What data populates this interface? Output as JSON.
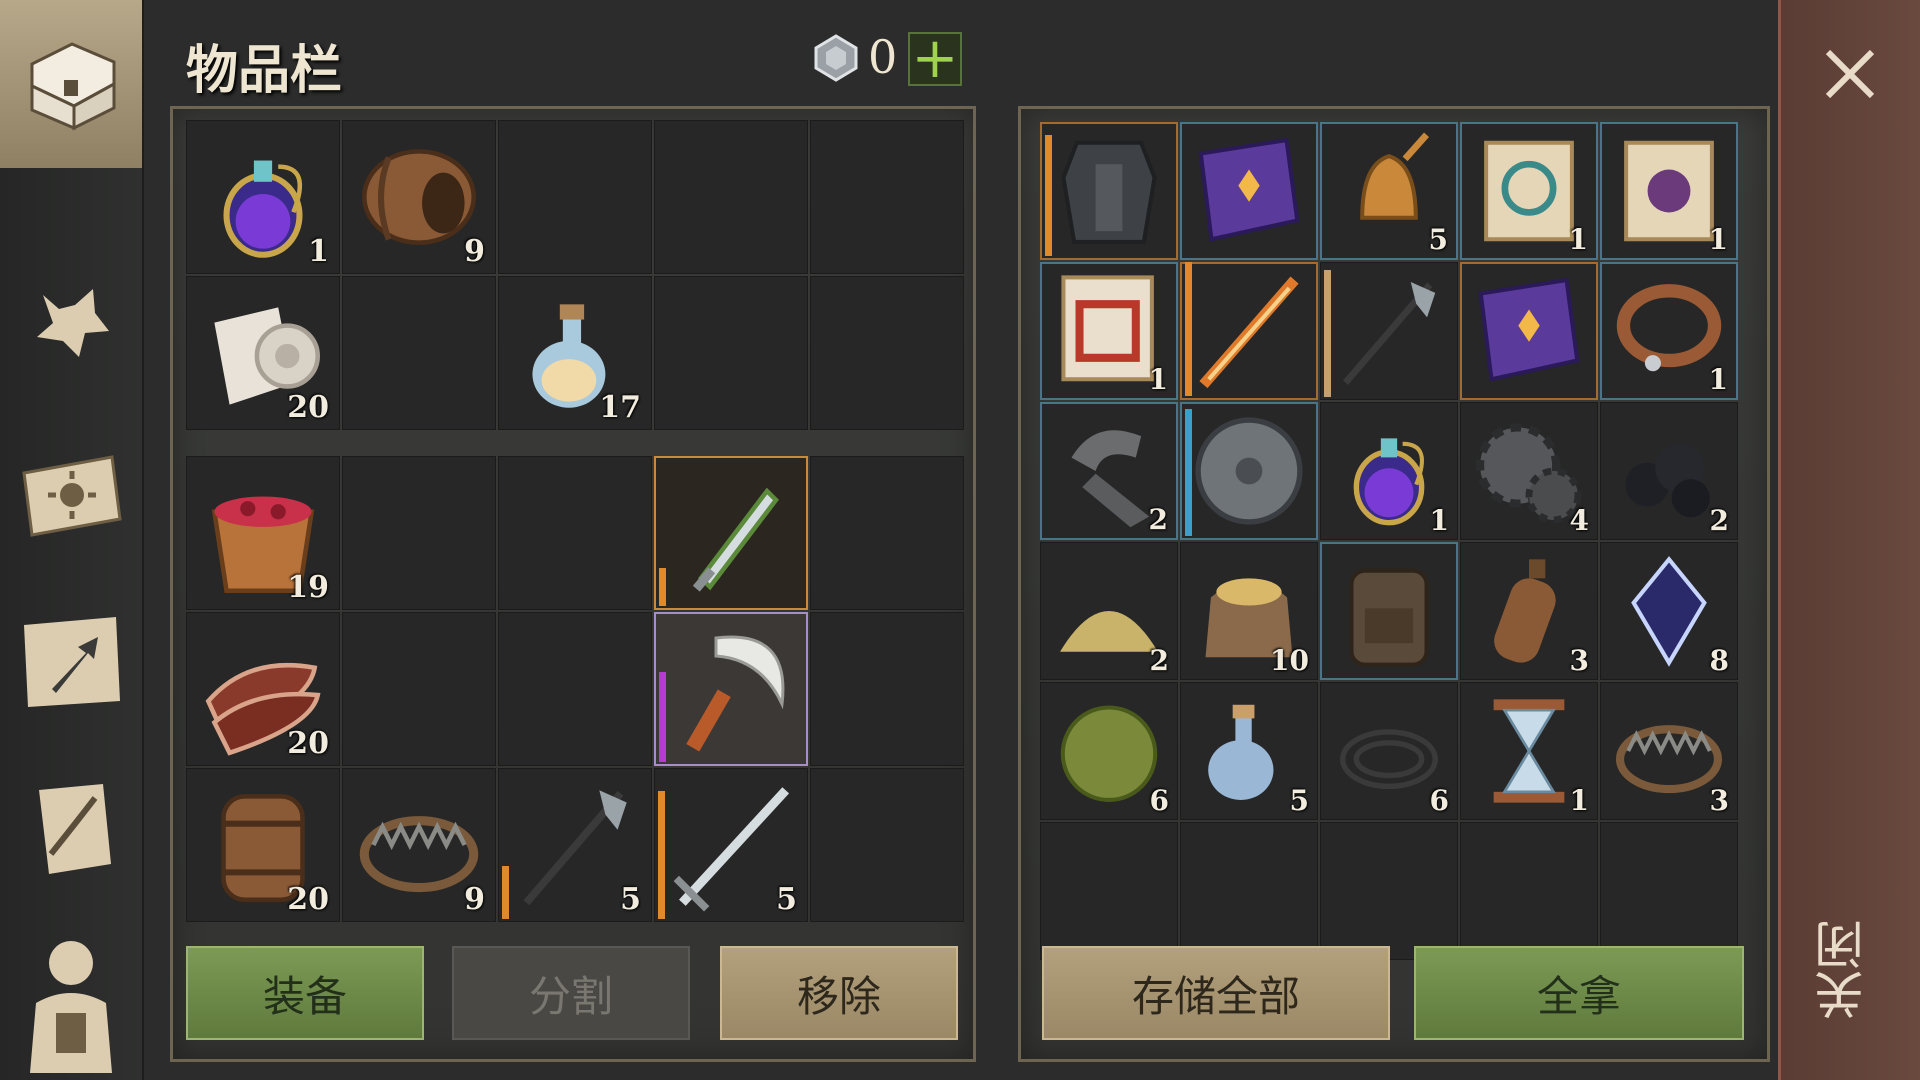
{
  "header": {
    "title": "物品栏",
    "coin_count": "0",
    "add_label": "+"
  },
  "left_nav": [
    {
      "name": "chest-icon"
    },
    {
      "name": "wolf-icon"
    },
    {
      "name": "sun-book-icon"
    },
    {
      "name": "map-arrow-icon"
    },
    {
      "name": "scroll-feather-icon"
    },
    {
      "name": "backpack-character-icon"
    }
  ],
  "inventory": [
    {
      "item": "purple-potion",
      "count": "1"
    },
    {
      "item": "barrel",
      "count": "9"
    },
    {
      "item": "",
      "count": ""
    },
    {
      "item": "",
      "count": ""
    },
    {
      "item": "",
      "count": ""
    },
    {
      "item": "cloth-roll",
      "count": "20"
    },
    {
      "item": "",
      "count": ""
    },
    {
      "item": "milk-bottle",
      "count": "17"
    },
    {
      "item": "",
      "count": ""
    },
    {
      "item": "",
      "count": ""
    },
    {
      "item": "berry-bucket",
      "count": "19"
    },
    {
      "item": "",
      "count": ""
    },
    {
      "item": "",
      "count": ""
    },
    {
      "item": "green-dagger",
      "count": ""
    },
    {
      "item": "",
      "count": ""
    },
    {
      "item": "meat-slabs",
      "count": "20"
    },
    {
      "item": "",
      "count": ""
    },
    {
      "item": "",
      "count": ""
    },
    {
      "item": "sickle",
      "count": ""
    },
    {
      "item": "",
      "count": ""
    },
    {
      "item": "keg",
      "count": "20"
    },
    {
      "item": "bear-trap",
      "count": "9"
    },
    {
      "item": "halberd",
      "count": "5"
    },
    {
      "item": "longsword",
      "count": "5"
    },
    {
      "item": "",
      "count": ""
    }
  ],
  "storage": [
    {
      "item": "chainmail",
      "count": ""
    },
    {
      "item": "purple-book",
      "count": ""
    },
    {
      "item": "bell",
      "count": "5"
    },
    {
      "item": "scroll-teal",
      "count": "1"
    },
    {
      "item": "scroll-purple",
      "count": "1"
    },
    {
      "item": "scroll-red",
      "count": "1"
    },
    {
      "item": "flame-sword",
      "count": ""
    },
    {
      "item": "halberd",
      "count": ""
    },
    {
      "item": "purple-book",
      "count": ""
    },
    {
      "item": "leather-collar",
      "count": "1"
    },
    {
      "item": "clamp",
      "count": "2"
    },
    {
      "item": "round-shield",
      "count": ""
    },
    {
      "item": "purple-potion",
      "count": "1"
    },
    {
      "item": "gears",
      "count": "4"
    },
    {
      "item": "coal",
      "count": "2"
    },
    {
      "item": "grain-pile",
      "count": "2"
    },
    {
      "item": "grain-sack",
      "count": "10"
    },
    {
      "item": "backpack",
      "count": ""
    },
    {
      "item": "leather-flask",
      "count": "3"
    },
    {
      "item": "crystal",
      "count": "8"
    },
    {
      "item": "herb-ball",
      "count": "6"
    },
    {
      "item": "water-bottle",
      "count": "5"
    },
    {
      "item": "rope",
      "count": "6"
    },
    {
      "item": "hourglass",
      "count": "1"
    },
    {
      "item": "bear-trap",
      "count": "3"
    },
    {
      "item": "",
      "count": ""
    },
    {
      "item": "",
      "count": ""
    },
    {
      "item": "",
      "count": ""
    },
    {
      "item": "",
      "count": ""
    },
    {
      "item": "",
      "count": ""
    }
  ],
  "buttons": {
    "equip": "装备",
    "split": "分割",
    "remove": "移除",
    "store_all": "存储全部",
    "take_all": "全拿"
  },
  "close": {
    "label": "关闭"
  },
  "colors": {
    "accent_green": "#7d9a55",
    "accent_tan": "#b3a07c",
    "rarity_orange": "#e08a2a",
    "rarity_purple": "#b43ccf",
    "rarity_blue": "#3aa0c8"
  }
}
